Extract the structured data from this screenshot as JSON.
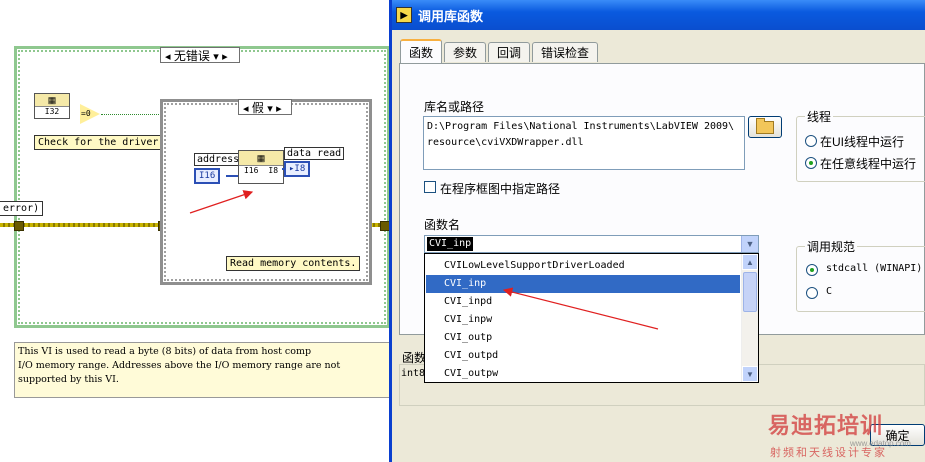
{
  "diagram": {
    "outer_case_label": "无错误",
    "inner_case_label": "假",
    "driver_comment": "Check for the driver.",
    "read_comment": "Read memory contents.",
    "error_label": "error)",
    "address_label": "address",
    "address_type": "I16",
    "data_read_label": "data read",
    "data_read_type": "I8",
    "node_top_i32": "I32",
    "compare_out": "=0",
    "node_i16_tag": "I16",
    "node_i8_tag": "I8",
    "description": "This VI is used to read a byte (8 bits) of data from host comp\nI/O memory range. Addresses above the I/O memory range are not\nsupported by this VI.",
    "wire_color": "#c8b400",
    "accent_blue": "#2b4fb5"
  },
  "dialog": {
    "title": "调用库函数",
    "tabs": [
      {
        "label": "函数",
        "active": true
      },
      {
        "label": "参数",
        "active": false
      },
      {
        "label": "回调",
        "active": false
      },
      {
        "label": "错误检查",
        "active": false
      }
    ],
    "library_path_label": "库名或路径",
    "library_path_value": "D:\\Program Files\\National Instruments\\LabVIEW 2009\\\nresource\\cviVXDWrapper.dll",
    "specify_path_label": "在程序框图中指定路径",
    "thread_group": {
      "title": "线程",
      "options": [
        {
          "label": "在UI线程中运行",
          "selected": false
        },
        {
          "label": "在任意线程中运行",
          "selected": true
        }
      ]
    },
    "function_name_label": "函数名",
    "function_name_value": "CVI_inp",
    "function_list": [
      {
        "label": "CVILowLevelSupportDriverLoaded",
        "selected": false
      },
      {
        "label": "CVI_inp",
        "selected": true
      },
      {
        "label": "CVI_inpd",
        "selected": false
      },
      {
        "label": "CVI_inpw",
        "selected": false
      },
      {
        "label": "CVI_outp",
        "selected": false
      },
      {
        "label": "CVI_outpd",
        "selected": false
      },
      {
        "label": "CVI_outpw",
        "selected": false
      }
    ],
    "calling_conv_group": {
      "title": "调用规范",
      "options": [
        {
          "label": "stdcall (WINAPI)",
          "selected": true
        },
        {
          "label": "C",
          "selected": false
        }
      ]
    },
    "prototype_label": "函数",
    "prototype_value": "int8",
    "ok_label": "确定",
    "title_bar_color": "#0a5adf",
    "selection_color": "#316ac5"
  },
  "watermark": {
    "brand": "易迪拓培训",
    "sub": "射频和天线设计专家",
    "url": "www.edatop.com"
  },
  "annotations": {
    "arrow_color": "#e02020"
  }
}
